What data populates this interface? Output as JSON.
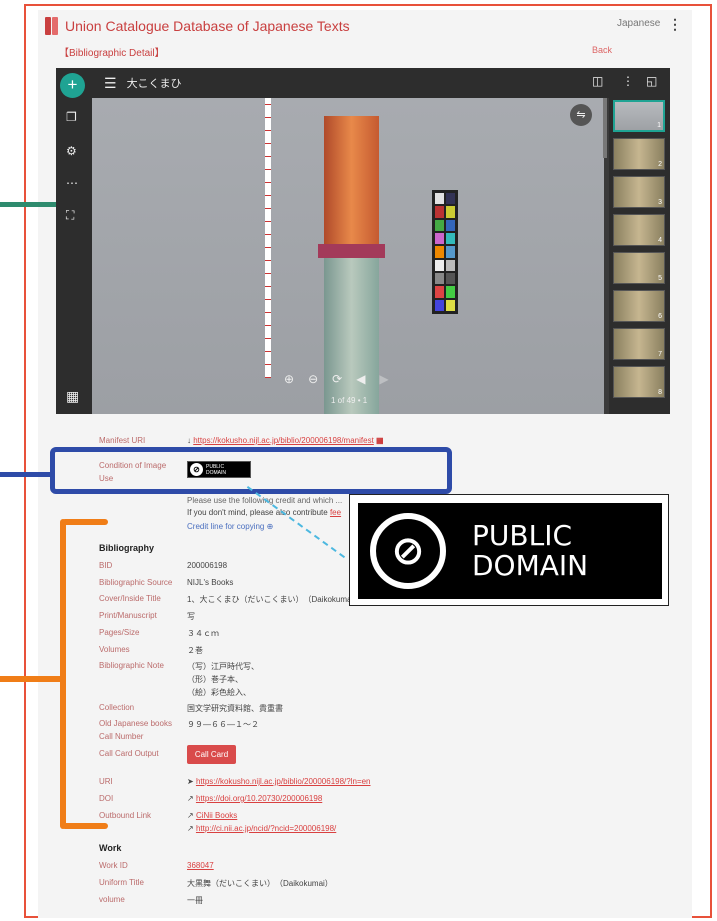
{
  "app": {
    "title": "Union Catalogue Database of Japanese Texts",
    "language": "Japanese",
    "bibliographic_detail": "【Bibliographic Detail】",
    "back": "Back"
  },
  "viewer": {
    "title": "大こくまひ",
    "pager": "1 of 49 • 1",
    "thumb_numbers": [
      "1",
      "2",
      "3",
      "4",
      "5",
      "6",
      "7",
      "8"
    ]
  },
  "meta": {
    "manifest_label": "Manifest URI",
    "manifest_value": "https://kokusho.nijl.ac.jp/biblio/200006198/manifest",
    "condition_label_1": "Condition of Image",
    "condition_label_2": "Use",
    "pd_badge_1": "PUBLIC",
    "pd_badge_2": "DOMAIN",
    "condition_line_1": "Please use the following credit and which ...",
    "condition_line_2": "If you don't mind, please also contribute ",
    "condition_line_2_link": "fee",
    "credit_line": "Credit line for copying",
    "bibliography_heading": "Bibliography",
    "rows": [
      {
        "label": "BID",
        "value": "200006198"
      },
      {
        "label": "Bibliographic Source",
        "value": "NIJL's Books"
      },
      {
        "label": "Cover/Inside Title",
        "value": "1、大こくまひ（だいこくまい）　（Daikokumai）"
      },
      {
        "label": "Print/Manuscript",
        "value": "写"
      },
      {
        "label": "Pages/Size",
        "value": "３４ｃｍ"
      },
      {
        "label": "Volumes",
        "value": "２巻"
      },
      {
        "label": "Bibliographic Note",
        "value": "（写）江戸時代写、"
      },
      {
        "label": "",
        "value": "（形）巻子本、"
      },
      {
        "label": "",
        "value": "（絵）彩色絵入、"
      },
      {
        "label": "Collection",
        "value": "国文学研究資料館、貴重書"
      },
      {
        "label": "Old Japanese books",
        "value": "９９―６６―１〜２"
      },
      {
        "label": "Call Number",
        "value": ""
      },
      {
        "label": "Call Card Output",
        "value": ""
      }
    ],
    "call_card_button": "Call Card",
    "uri_label": "URI",
    "uri_value": "https://kokusho.nijl.ac.jp/biblio/200006198/?ln=en",
    "doi_label": "DOI",
    "doi_value": "https://doi.org/10.20730/200006198",
    "outbound_label": "Outbound Link",
    "outbound_1": "CiNii Books",
    "outbound_2": "http://ci.nii.ac.jp/ncid/?ncid=200006198/",
    "work_heading": "Work",
    "work_rows": [
      {
        "label": "Work ID",
        "value": "368047"
      },
      {
        "label": "Uniform Title",
        "value": "大黒舞（だいこくまい）　（Daikokumai）"
      },
      {
        "label": "volume",
        "value": "一冊"
      }
    ]
  },
  "big_badge": {
    "line1": "PUBLIC",
    "line2": "DOMAIN"
  },
  "colors": {
    "accent": "#c94040",
    "teal": "#1fa393",
    "annotation_blue": "#2e4ba8",
    "annotation_orange": "#f07d17",
    "annotation_green": "#2e8b6e"
  }
}
